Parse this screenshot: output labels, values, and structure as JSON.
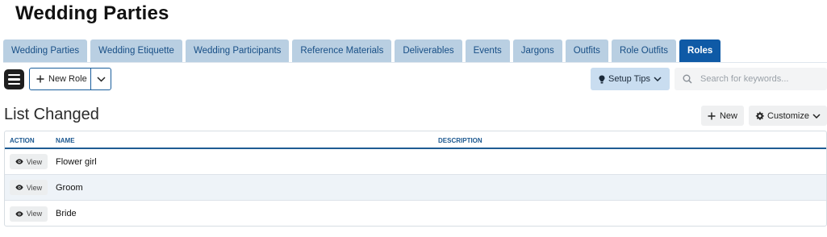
{
  "page": {
    "title": "Wedding Parties"
  },
  "tabs": [
    {
      "label": "Wedding Parties",
      "active": false
    },
    {
      "label": "Wedding Etiquette",
      "active": false
    },
    {
      "label": "Wedding Participants",
      "active": false
    },
    {
      "label": "Reference Materials",
      "active": false
    },
    {
      "label": "Deliverables",
      "active": false
    },
    {
      "label": "Events",
      "active": false
    },
    {
      "label": "Jargons",
      "active": false
    },
    {
      "label": "Outfits",
      "active": false
    },
    {
      "label": "Role Outfits",
      "active": false
    },
    {
      "label": "Roles",
      "active": true
    }
  ],
  "toolbar": {
    "menu_icon": "hamburger-icon",
    "new_role_label": "New Role",
    "setup_tips_label": "Setup Tips",
    "search_placeholder": "Search for keywords..."
  },
  "list": {
    "title": "List Changed",
    "new_label": "New",
    "customize_label": "Customize",
    "columns": {
      "action": "ACTION",
      "name": "NAME",
      "description": "DESCRIPTION"
    },
    "rows": [
      {
        "action": "View",
        "name": "Flower girl",
        "description": ""
      },
      {
        "action": "View",
        "name": "Groom",
        "description": ""
      },
      {
        "action": "View",
        "name": "Bride",
        "description": ""
      }
    ]
  },
  "colors": {
    "tab_bg": "#b9cfe2",
    "tab_active_bg": "#0f5aa6",
    "accent": "#1f5c93",
    "row_alt": "#eef3f8"
  }
}
